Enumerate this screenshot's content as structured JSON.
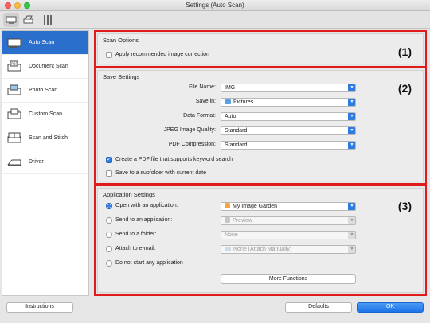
{
  "window": {
    "title": "Settings (Auto Scan)"
  },
  "sidebar": {
    "items": [
      {
        "label": "Auto Scan",
        "icon": "auto-scan-icon",
        "selected": true
      },
      {
        "label": "Document Scan",
        "icon": "document-scan-icon",
        "selected": false
      },
      {
        "label": "Photo Scan",
        "icon": "photo-scan-icon",
        "selected": false
      },
      {
        "label": "Custom Scan",
        "icon": "custom-scan-icon",
        "selected": false
      },
      {
        "label": "Scan and Stitch",
        "icon": "scan-and-stitch-icon",
        "selected": false
      },
      {
        "label": "Driver",
        "icon": "driver-icon",
        "selected": false
      }
    ]
  },
  "scan_options": {
    "title": "Scan Options",
    "marker": "(1)",
    "apply_correction": {
      "label": "Apply recommended image correction",
      "checked": false
    }
  },
  "save_settings": {
    "title": "Save Settings",
    "marker": "(2)",
    "file_name": {
      "label": "File Name:",
      "value": "IMG"
    },
    "save_in": {
      "label": "Save in:",
      "value": "Pictures"
    },
    "data_format": {
      "label": "Data Format:",
      "value": "Auto"
    },
    "jpeg_quality": {
      "label": "JPEG Image Quality:",
      "value": "Standard"
    },
    "pdf_compression": {
      "label": "PDF Compression:",
      "value": "Standard"
    },
    "create_pdf": {
      "label": "Create a PDF file that supports keyword search",
      "checked": true
    },
    "save_subfolder": {
      "label": "Save to a subfolder with current date",
      "checked": false
    }
  },
  "app_settings": {
    "title": "Application Settings",
    "marker": "(3)",
    "open_with": {
      "label": "Open with an application:",
      "value": "My Image Garden",
      "selected": true
    },
    "send_to_app": {
      "label": "Send to an application:",
      "value": "Preview",
      "selected": false
    },
    "send_to_folder": {
      "label": "Send to a folder:",
      "value": "None",
      "selected": false
    },
    "attach_email": {
      "label": "Attach to e-mail:",
      "value": "None (Attach Manually)",
      "selected": false
    },
    "do_not_start": {
      "label": "Do not start any application",
      "selected": false
    },
    "more_functions": "More Functions"
  },
  "footer": {
    "instructions": "Instructions",
    "defaults": "Defaults",
    "ok": "OK"
  },
  "colors": {
    "accent": "#2f7be0",
    "highlight_border": "#e01b1b",
    "selected_sidebar": "#2a6fcc"
  }
}
